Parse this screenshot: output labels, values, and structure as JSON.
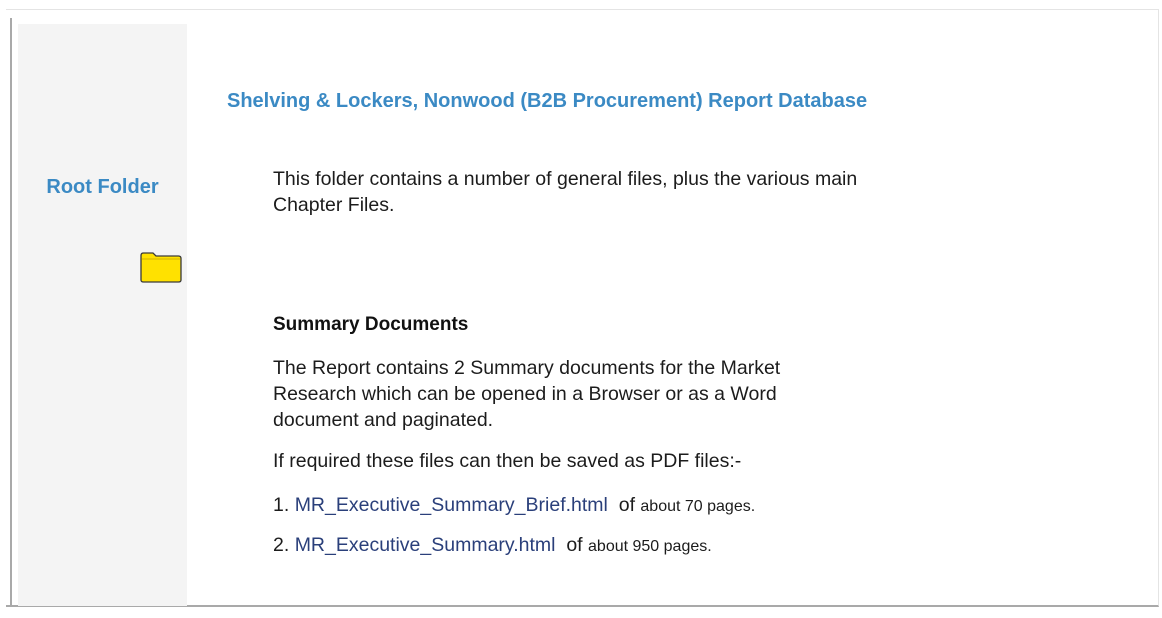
{
  "sidebar": {
    "title": "Root Folder",
    "icon": "folder-icon"
  },
  "main": {
    "report_title": "Shelving & Lockers, Nonwood (B2B Procurement) Report Database",
    "intro": "This folder contains a number of general files, plus the various main Chapter Files.",
    "summary_heading": "Summary Documents",
    "summary_body": "The Report contains 2 Summary documents for the Market Research which can be opened in a Browser or as a Word document and paginated.",
    "pdf_note": "If required these files can then be saved as PDF files:-",
    "items": [
      {
        "number": "1.",
        "link_text": "MR_Executive_Summary_Brief.html",
        "of": "of",
        "pages_text": "about 70 pages."
      },
      {
        "number": "2.",
        "link_text": "MR_Executive_Summary.html",
        "of": "of",
        "pages_text": "about 950 pages."
      }
    ]
  },
  "colors": {
    "accent": "#3b8ac4",
    "link": "#2a3f7a",
    "sidebar_bg": "#f4f4f4",
    "folder_fill": "#ffe100"
  }
}
